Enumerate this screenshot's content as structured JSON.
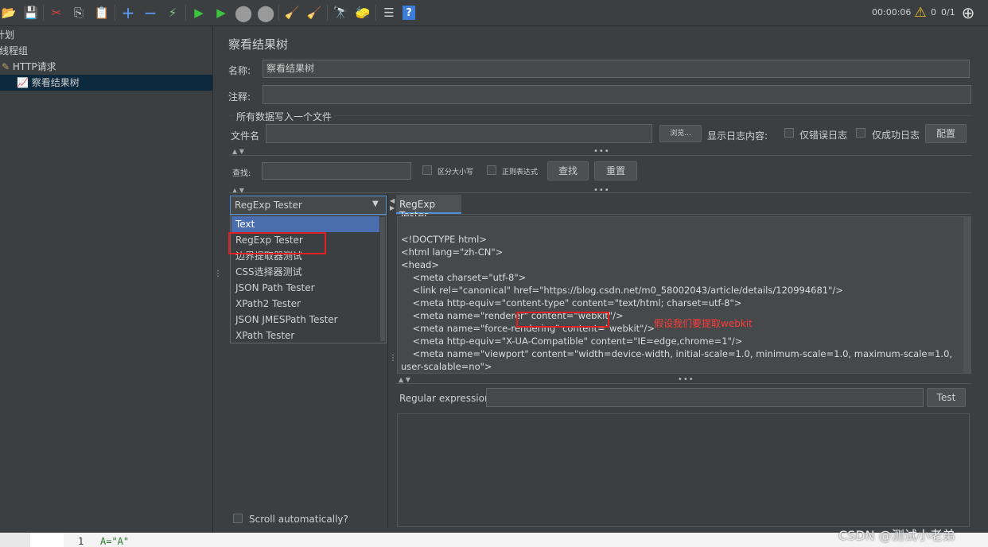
{
  "toolbar": {
    "timer": "00:00:06",
    "warnings": "0",
    "threads": "0/1"
  },
  "tree": {
    "items": [
      "计划",
      "线程组",
      "HTTP请求",
      "察看结果树"
    ]
  },
  "panel": {
    "title": "察看结果树",
    "name_label": "名称:",
    "name_value": "察看结果树",
    "comment_label": "注释:",
    "comment_value": "",
    "file_section_title": "所有数据写入一个文件",
    "filename_label": "文件名",
    "filename_value": "",
    "browse_label": "浏览...",
    "log_content_label": "显示日志内容:",
    "errors_only_label": "仅错误日志",
    "success_only_label": "仅成功日志",
    "config_label": "配置"
  },
  "search": {
    "label": "查找:",
    "value": "",
    "case_sensitive_label": "区分大小写",
    "regex_label": "正则表达式",
    "find_label": "查找",
    "reset_label": "重置"
  },
  "renderer": {
    "selected": "RegExp Tester",
    "options": [
      "Text",
      "RegExp Tester",
      "边界提取器测试",
      "CSS选择器测试",
      "JSON Path Tester",
      "XPath2 Tester",
      "JSON JMESPath Tester",
      "XPath Tester"
    ],
    "scroll_auto_label": "Scroll automatically?"
  },
  "result": {
    "tab_label": "RegExp Tester",
    "code_lines": [
      "<!DOCTYPE html>",
      "<html lang=\"zh-CN\">",
      "<head>",
      "    <meta charset=\"utf-8\">",
      "    <link rel=\"canonical\" href=\"https://blog.csdn.net/m0_58002043/article/details/120994681\"/>",
      "    <meta http-equiv=\"content-type\" content=\"text/html; charset=utf-8\">",
      "    <meta name=\"renderer\" content=\"webkit\"/>",
      "    <meta name=\"force-rendering\" content=\"webkit\"/>",
      "    <meta http-equiv=\"X-UA-Compatible\" content=\"IE=edge,chrome=1\"/>",
      "    <meta name=\"viewport\" content=\"width=device-width, initial-scale=1.0, minimum-scale=1.0, maximum-scale=1.0,",
      "user-scalable=no\">"
    ],
    "annotation": "假设我们要提取webkit",
    "regex_label": "Regular expression:",
    "regex_value": "",
    "test_label": "Test"
  },
  "bottom": {
    "line_number": "1",
    "code_text": "A=\"A\""
  },
  "watermark": "CSDN @测试小老弟",
  "colors": {
    "background": "#3c3f41",
    "selection": "#4b6eaf",
    "highlight_box": "#e02020",
    "annotation": "#ff3b3b"
  }
}
